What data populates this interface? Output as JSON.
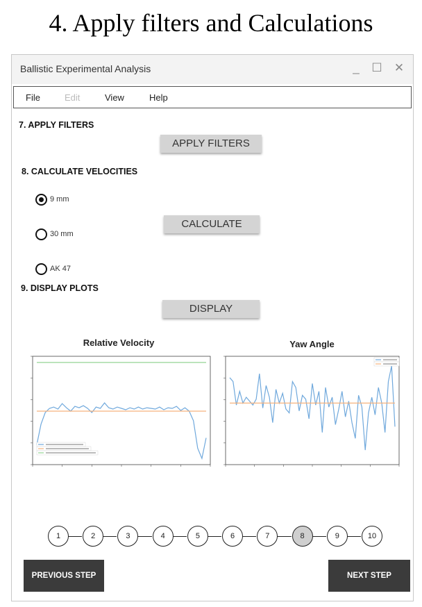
{
  "heading": "4. Apply filters and Calculations",
  "window": {
    "title": "Ballistic Experimental Analysis",
    "controls": {
      "minimize": "_",
      "maximize": "☐",
      "close": "✕"
    }
  },
  "menu": {
    "file": "File",
    "edit": "Edit",
    "view": "View",
    "help": "Help"
  },
  "filters": {
    "section": "7. APPLY FILTERS",
    "button": "APPLY FILTERS"
  },
  "velocities": {
    "section": "8. CALCULATE VELOCITIES",
    "options": [
      {
        "label": "9 mm",
        "selected": true
      },
      {
        "label": "30 mm",
        "selected": false
      },
      {
        "label": "AK 47",
        "selected": false
      }
    ],
    "button": "CALCULATE"
  },
  "display": {
    "section": "9. DISPLAY PLOTS",
    "button": "DISPLAY"
  },
  "plots": {
    "relative_velocity": {
      "title": "Relative Velocity"
    },
    "yaw_angle": {
      "title": "Yaw Angle"
    }
  },
  "stepper": {
    "steps": [
      "1",
      "2",
      "3",
      "4",
      "5",
      "6",
      "7",
      "8",
      "9",
      "10"
    ],
    "active_index": 7
  },
  "nav": {
    "previous": "PREVIOUS STEP",
    "next": "NEXT STEP"
  },
  "chart_data": [
    {
      "type": "line",
      "title": "Relative Velocity",
      "series": [
        {
          "color": "#6fa8dc",
          "x": [
            0,
            1,
            2,
            3,
            4,
            5,
            6,
            7,
            8,
            9,
            10,
            11,
            12,
            13,
            14,
            15,
            16,
            17,
            18,
            19,
            20,
            21,
            22,
            23,
            24,
            25,
            26,
            27,
            28,
            29,
            30,
            31,
            32,
            33,
            34,
            35,
            36,
            37,
            38,
            39,
            40
          ],
          "y": [
            0.25,
            0.55,
            0.72,
            0.78,
            0.8,
            0.77,
            0.85,
            0.79,
            0.74,
            0.81,
            0.79,
            0.82,
            0.78,
            0.72,
            0.8,
            0.78,
            0.86,
            0.79,
            0.77,
            0.8,
            0.78,
            0.76,
            0.79,
            0.77,
            0.8,
            0.77,
            0.79,
            0.78,
            0.77,
            0.8,
            0.76,
            0.79,
            0.78,
            0.81,
            0.75,
            0.79,
            0.74,
            0.6,
            0.2,
            0.05,
            0.35
          ]
        },
        {
          "color": "#f5b27d",
          "x": [
            0,
            40
          ],
          "y": [
            0.74,
            0.74
          ]
        },
        {
          "color": "#93d493",
          "x": [
            0,
            40
          ],
          "y": [
            1.45,
            1.45
          ]
        }
      ],
      "ylim": [
        0,
        1.5
      ]
    },
    {
      "type": "line",
      "title": "Yaw Angle",
      "legend": "top-right",
      "series": [
        {
          "color": "#6fa8dc",
          "x": [
            0,
            1,
            2,
            3,
            4,
            5,
            6,
            7,
            8,
            9,
            10,
            11,
            12,
            13,
            14,
            15,
            16,
            17,
            18,
            19,
            20,
            21,
            22,
            23,
            24,
            25,
            26,
            27,
            28,
            29,
            30,
            31,
            32,
            33,
            34,
            35,
            36,
            37,
            38,
            39,
            40,
            41,
            42,
            43,
            44,
            45,
            46,
            47,
            48,
            49,
            50
          ],
          "y": [
            0.86,
            0.82,
            0.58,
            0.72,
            0.6,
            0.66,
            0.62,
            0.58,
            0.64,
            0.9,
            0.55,
            0.78,
            0.66,
            0.4,
            0.74,
            0.6,
            0.7,
            0.54,
            0.5,
            0.82,
            0.76,
            0.52,
            0.68,
            0.64,
            0.44,
            0.8,
            0.58,
            0.72,
            0.3,
            0.76,
            0.56,
            0.66,
            0.38,
            0.54,
            0.72,
            0.46,
            0.62,
            0.4,
            0.24,
            0.68,
            0.56,
            0.12,
            0.5,
            0.66,
            0.48,
            0.76,
            0.6,
            0.3,
            0.82,
            0.98,
            0.36
          ]
        },
        {
          "color": "#f5b27d",
          "x": [
            0,
            50
          ],
          "y": [
            0.6,
            0.6
          ]
        }
      ],
      "ylim": [
        0,
        1.05
      ]
    }
  ]
}
